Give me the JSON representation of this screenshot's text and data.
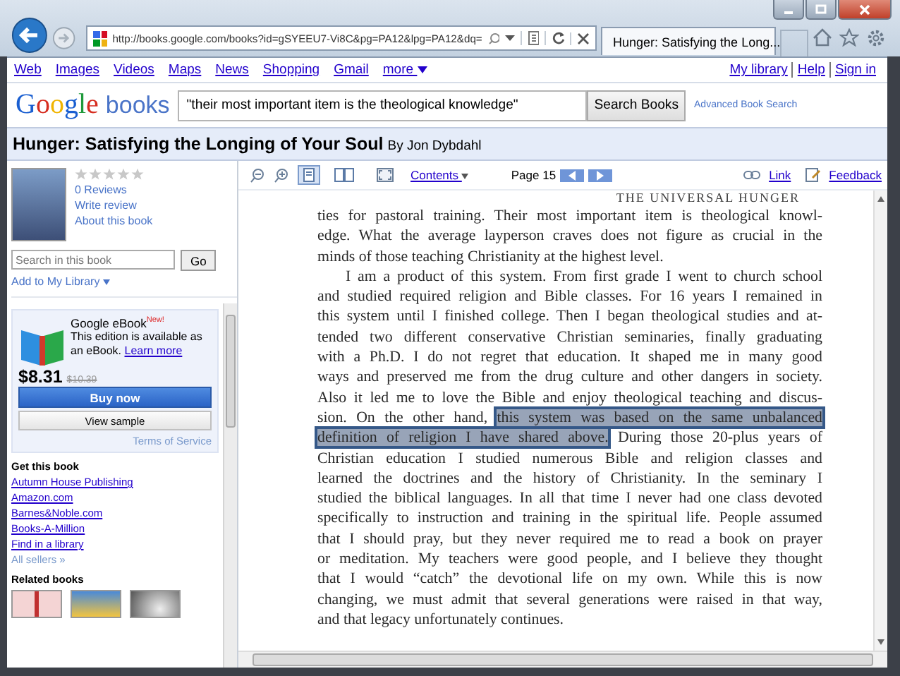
{
  "browser": {
    "address": "http://books.google.com/books?id=gSYEEU7-Vi8C&pg=PA12&lpg=PA12&dq=",
    "tab_title": "Hunger: Satisfying the Long..."
  },
  "nav": {
    "left": [
      "Web",
      "Images",
      "Videos",
      "Maps",
      "News",
      "Shopping",
      "Gmail"
    ],
    "more": "more",
    "right": [
      "My library",
      "Help",
      "Sign in"
    ]
  },
  "search": {
    "logo_google": "Google",
    "logo_books": "books",
    "query": "\"their most important item is the theological knowledge\"",
    "button": "Search Books",
    "advanced": "Advanced Book Search"
  },
  "book": {
    "title": "Hunger: Satisfying the Longing of Your Soul",
    "byline": "By Jon Dybdahl"
  },
  "sidebar": {
    "stars": 0,
    "links": [
      "0 Reviews",
      "Write review",
      "About this book"
    ],
    "search_placeholder": "Search in this book",
    "go": "Go",
    "add_library": "Add to My Library",
    "ebook": {
      "title": "Google eBook",
      "badge": "New!",
      "description": "This edition is available as an eBook.",
      "learn_more": "Learn more",
      "price": "$8.31",
      "list_price": "$10.39",
      "buy": "Buy now",
      "sample": "View sample",
      "terms": "Terms of Service"
    },
    "get_heading": "Get this book",
    "sellers": [
      "Autumn House Publishing",
      "Amazon.com",
      "Barnes&Noble.com",
      "Books-A-Million",
      "Find in a library"
    ],
    "all_sellers": "All sellers »",
    "related_heading": "Related books"
  },
  "viewer": {
    "view_modes": [
      {
        "selected": true
      },
      {
        "selected": false
      }
    ],
    "contents": "Contents",
    "page": "Page 15",
    "link": "Link",
    "feedback": "Feedback",
    "running_head": "THE UNIVERSAL HUNGER",
    "lines": [
      {
        "kind": "body",
        "segments": [
          {
            "text": "ties for pastoral training. Their most important item is theological knowl-",
            "highlighted": false
          }
        ]
      },
      {
        "kind": "body",
        "segments": [
          {
            "text": "edge. What the average layperson craves does not figure as crucial in the",
            "highlighted": false
          }
        ]
      },
      {
        "kind": "end",
        "segments": [
          {
            "text": "minds of those teaching Christianity at the highest level.",
            "highlighted": false
          }
        ]
      },
      {
        "kind": "indent",
        "segments": [
          {
            "text": "I am a product of this system. From first grade I went to church school",
            "highlighted": false
          }
        ]
      },
      {
        "kind": "body",
        "segments": [
          {
            "text": "and studied required religion and Bible classes. For 16 years I remained in",
            "highlighted": false
          }
        ]
      },
      {
        "kind": "body",
        "segments": [
          {
            "text": "this system until I finished college. Then I began theological studies and at-",
            "highlighted": false
          }
        ]
      },
      {
        "kind": "body",
        "segments": [
          {
            "text": "tended two different conservative Christian seminaries, finally graduating",
            "highlighted": false
          }
        ]
      },
      {
        "kind": "body",
        "segments": [
          {
            "text": "with a Ph.D. I do not regret that education. It shaped me in many good",
            "highlighted": false
          }
        ]
      },
      {
        "kind": "body",
        "segments": [
          {
            "text": "ways and preserved me from the drug culture and other dangers in society.",
            "highlighted": false
          }
        ]
      },
      {
        "kind": "body",
        "segments": [
          {
            "text": "Also it led me to love the Bible and enjoy theological teaching and discus-",
            "highlighted": false
          }
        ]
      },
      {
        "kind": "body",
        "segments": [
          {
            "text": "sion. On the other hand,",
            "highlighted": false
          },
          {
            "text": "this system was based on the same unbalanced",
            "highlighted": true
          }
        ]
      },
      {
        "kind": "body",
        "segments": [
          {
            "text": "definition of religion I have shared above.",
            "highlighted": true
          },
          {
            "text": "During those 20-plus years of",
            "highlighted": false
          }
        ]
      },
      {
        "kind": "body",
        "segments": [
          {
            "text": "Christian education I studied numerous Bible and religion classes and",
            "highlighted": false
          }
        ]
      },
      {
        "kind": "body",
        "segments": [
          {
            "text": "learned the doctrines and the history of Christianity. In the seminary I",
            "highlighted": false
          }
        ]
      },
      {
        "kind": "body",
        "segments": [
          {
            "text": "studied the biblical languages. In all that time I never had one class devoted",
            "highlighted": false
          }
        ]
      },
      {
        "kind": "body",
        "segments": [
          {
            "text": "specifically to instruction and training in the spiritual life. People assumed",
            "highlighted": false
          }
        ]
      },
      {
        "kind": "body",
        "segments": [
          {
            "text": "that I should pray, but they never required me to read a book on prayer",
            "highlighted": false
          }
        ]
      },
      {
        "kind": "body",
        "segments": [
          {
            "text": "or meditation. My teachers were good people, and I believe they thought",
            "highlighted": false
          }
        ]
      },
      {
        "kind": "body",
        "segments": [
          {
            "text": "that I would “catch” the devotional life on my own. While this is now",
            "highlighted": false
          }
        ]
      },
      {
        "kind": "body",
        "segments": [
          {
            "text": "changing, we must admit that several generations were raised in that way,",
            "highlighted": false
          }
        ]
      },
      {
        "kind": "end",
        "segments": [
          {
            "text": "and that legacy unfortunately continues.",
            "highlighted": false
          }
        ]
      }
    ]
  }
}
